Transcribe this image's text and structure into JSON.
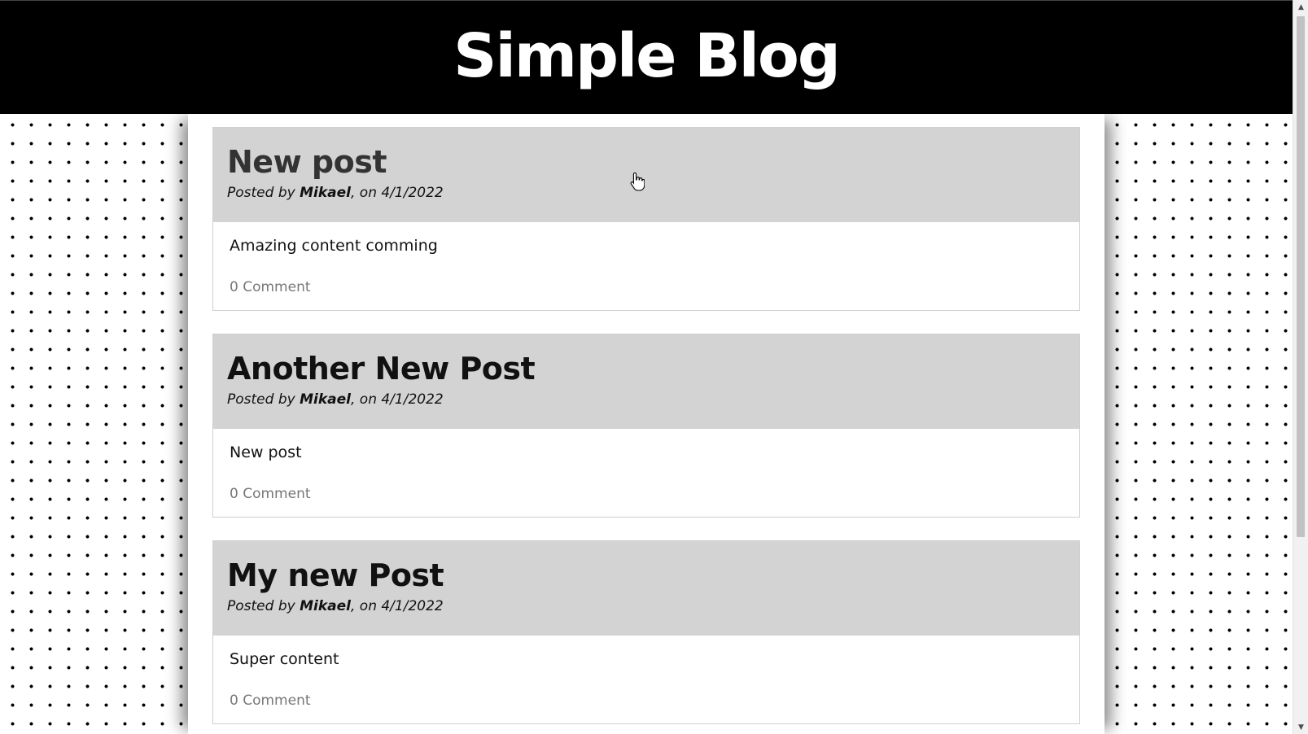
{
  "header": {
    "title": "Simple Blog"
  },
  "posts": [
    {
      "title": "New post",
      "meta_prefix": "Posted by ",
      "author": "Mikael",
      "meta_suffix": ", on 4/1/2022",
      "content": "Amazing content comming",
      "comments": "0 Comment"
    },
    {
      "title": "Another New Post",
      "meta_prefix": "Posted by ",
      "author": "Mikael",
      "meta_suffix": ", on 4/1/2022",
      "content": "New post",
      "comments": "0 Comment"
    },
    {
      "title": "My new Post",
      "meta_prefix": "Posted by ",
      "author": "Mikael",
      "meta_suffix": ", on 4/1/2022",
      "content": "Super content",
      "comments": "0 Comment"
    }
  ],
  "colors": {
    "header_bg": "#000000",
    "post_header_bg": "#d3d3d3",
    "comment_text": "#777777"
  },
  "icons": {
    "cursor": "hand-pointer-icon",
    "scroll_up": "triangle-up-icon",
    "scroll_down": "triangle-down-icon"
  }
}
